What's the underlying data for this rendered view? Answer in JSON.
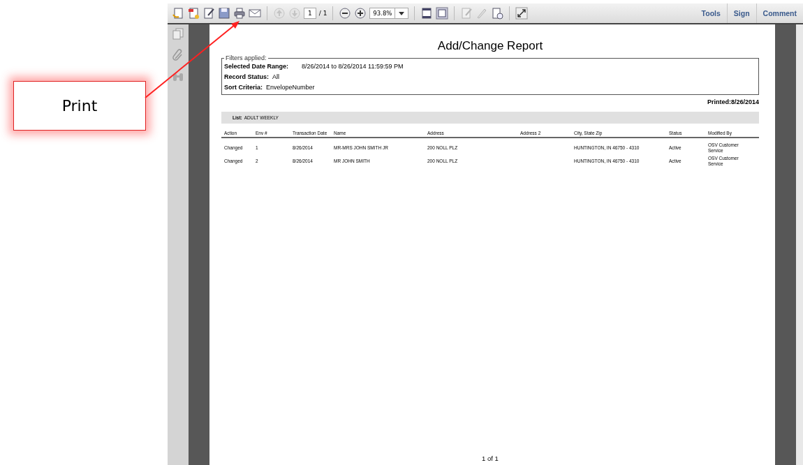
{
  "annotation": {
    "label": "Print"
  },
  "toolbar": {
    "page_number": "1",
    "page_total": "/ 1",
    "zoom": "93.8%",
    "links": [
      {
        "label": "Tools"
      },
      {
        "label": "Sign"
      },
      {
        "label": "Comment"
      }
    ]
  },
  "report": {
    "title": "Add/Change Report",
    "filters_legend": "Filters applied:",
    "filters": [
      {
        "label": "Selected Date Range:",
        "value": "8/26/2014 to 8/26/2014 11:59:59 PM"
      },
      {
        "label": "Record Status:",
        "value": "All"
      },
      {
        "label": "Sort Criteria:",
        "value": "EnvelopeNumber"
      }
    ],
    "printed": "Printed:8/26/2014",
    "list_label": "List:",
    "list_name": "ADULT WEEKLY",
    "columns": [
      "Action",
      "Env #",
      "Transaction Date",
      "Name",
      "Address",
      "Address 2",
      "City, State Zip",
      "Status",
      "Modified By"
    ],
    "rows": [
      [
        "Changed",
        "1",
        "8/26/2014",
        "MR-MRS JOHN SMITH JR",
        "200 NOLL PLZ",
        "",
        "HUNTINGTON, IN 46750 - 4310",
        "Active",
        "OSV Customer Service"
      ],
      [
        "Changed",
        "2",
        "8/26/2014",
        "MR JOHN SMITH",
        "200 NOLL PLZ",
        "",
        "HUNTINGTON, IN 46750 - 4310",
        "Active",
        "OSV Customer Service"
      ]
    ],
    "page_footer": "1 of 1"
  }
}
